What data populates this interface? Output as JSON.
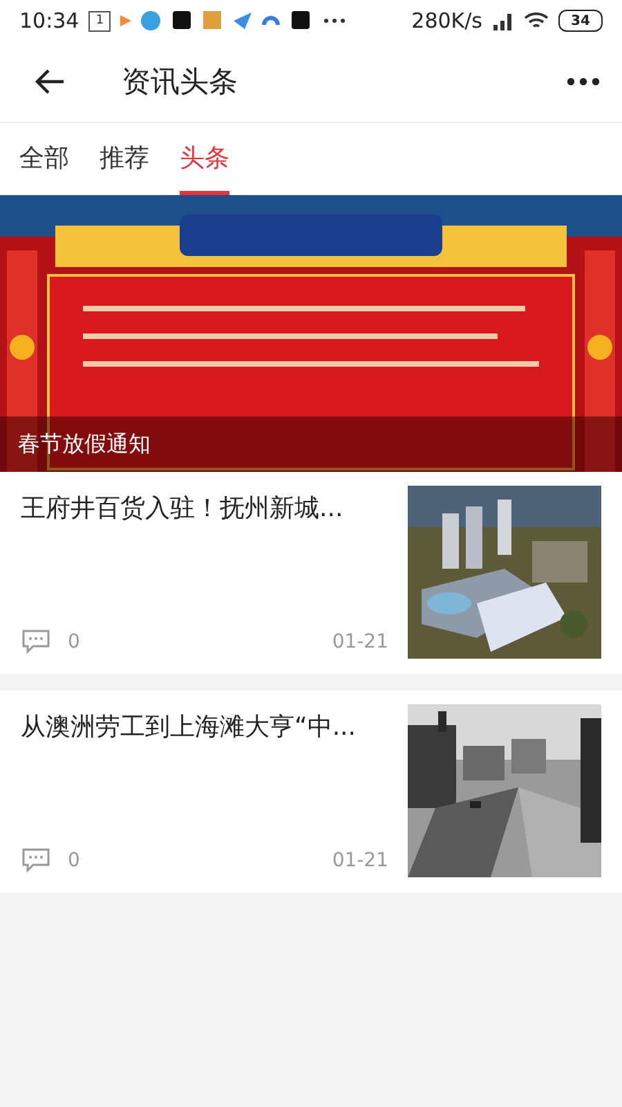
{
  "status_bar": {
    "time": "10:34",
    "notification_count": "1",
    "speed": "280K/s",
    "battery": "34"
  },
  "header": {
    "title": "资讯头条"
  },
  "tabs": [
    {
      "label": "全部",
      "selected": false
    },
    {
      "label": "推荐",
      "selected": false
    },
    {
      "label": "头条",
      "selected": true
    }
  ],
  "banner": {
    "kind": "picture",
    "caption": "春节放假通知"
  },
  "articles": [
    {
      "title": "王府井百货入驻！抚州新城...",
      "comments": "0",
      "date": "01-21"
    },
    {
      "title": "从澳洲劳工到上海滩大亨“中...",
      "comments": "0",
      "date": "01-21"
    }
  ]
}
